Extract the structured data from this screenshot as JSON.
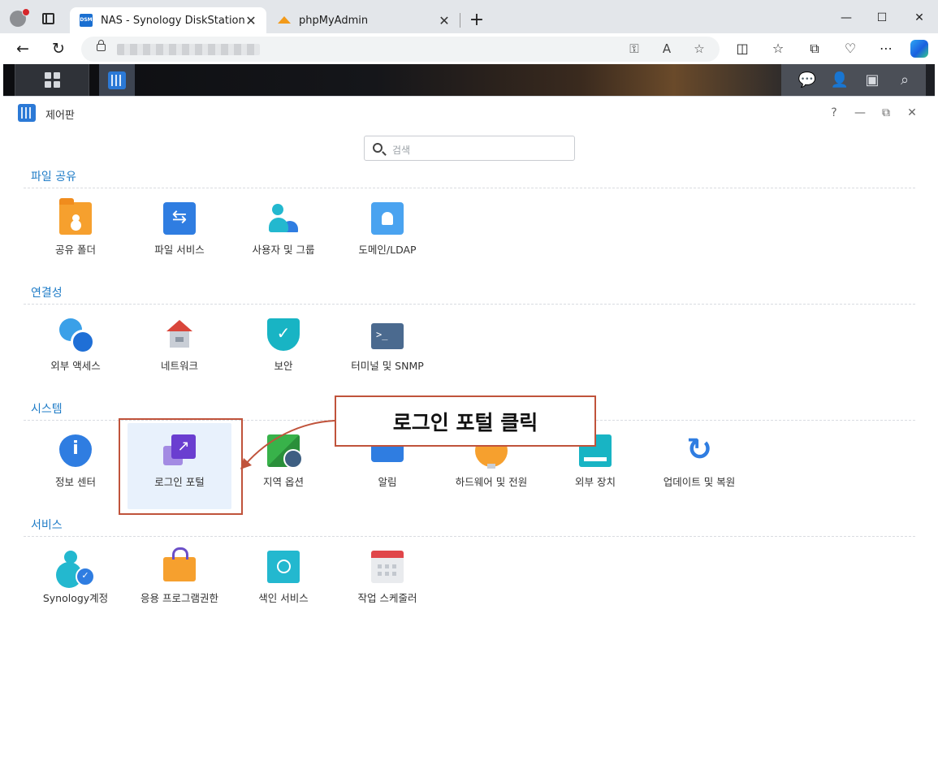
{
  "browser": {
    "tabs": [
      {
        "title": "NAS - Synology DiskStation",
        "favicon": "dsm",
        "active": true
      },
      {
        "title": "phpMyAdmin",
        "favicon": "pma",
        "active": false
      }
    ],
    "favicon_dsm_text": "DSM",
    "close_glyph": "✕",
    "new_tab_glyph": "+",
    "window_controls": {
      "minimize": "—",
      "maximize": "☐",
      "close": "✕"
    },
    "nav": {
      "back": "←",
      "refresh": "↻"
    },
    "address_icons": {
      "key": "⚿",
      "read_aloud": "A",
      "favorite": "☆"
    },
    "toolbar_icons": {
      "split": "◫",
      "favorites": "☆",
      "collections": "⧉",
      "health": "♡",
      "more": "⋯"
    }
  },
  "dsm": {
    "accent": "#1f7cc7"
  },
  "window": {
    "title": "제어판",
    "controls": {
      "help": "?",
      "minimize": "—",
      "restore": "⧉",
      "close": "✕"
    }
  },
  "search": {
    "placeholder": "검색"
  },
  "sections": [
    {
      "title": "파일 공유",
      "items": [
        {
          "label": "공유 폴더",
          "icon": "shared-folder-icon"
        },
        {
          "label": "파일 서비스",
          "icon": "file-services-icon"
        },
        {
          "label": "사용자 및 그룹",
          "icon": "users-groups-icon"
        },
        {
          "label": "도메인/LDAP",
          "icon": "domain-ldap-icon"
        }
      ]
    },
    {
      "title": "연결성",
      "items": [
        {
          "label": "외부 액세스",
          "icon": "external-access-icon"
        },
        {
          "label": "네트워크",
          "icon": "network-icon"
        },
        {
          "label": "보안",
          "icon": "security-shield-icon"
        },
        {
          "label": "터미널 및 SNMP",
          "icon": "terminal-icon"
        }
      ]
    },
    {
      "title": "시스템",
      "items": [
        {
          "label": "정보 센터",
          "icon": "info-center-icon"
        },
        {
          "label": "로그인 포털",
          "icon": "login-portal-icon",
          "selected": true
        },
        {
          "label": "지역 옵션",
          "icon": "regional-options-icon"
        },
        {
          "label": "알림",
          "icon": "notification-icon"
        },
        {
          "label": "하드웨어 및 전원",
          "icon": "hardware-power-icon"
        },
        {
          "label": "외부 장치",
          "icon": "external-devices-icon"
        },
        {
          "label": "업데이트 및 복원",
          "icon": "update-restore-icon"
        }
      ]
    },
    {
      "title": "서비스",
      "items": [
        {
          "label": "Synology계정",
          "icon": "synology-account-icon"
        },
        {
          "label": "응용 프로그램권한",
          "icon": "application-privileges-icon"
        },
        {
          "label": "색인 서비스",
          "icon": "indexing-service-icon"
        },
        {
          "label": "작업 스케줄러",
          "icon": "task-scheduler-icon"
        }
      ]
    }
  ],
  "annotation": {
    "callout_text": "로그인 포털 클릭",
    "color": "#c0533b"
  }
}
